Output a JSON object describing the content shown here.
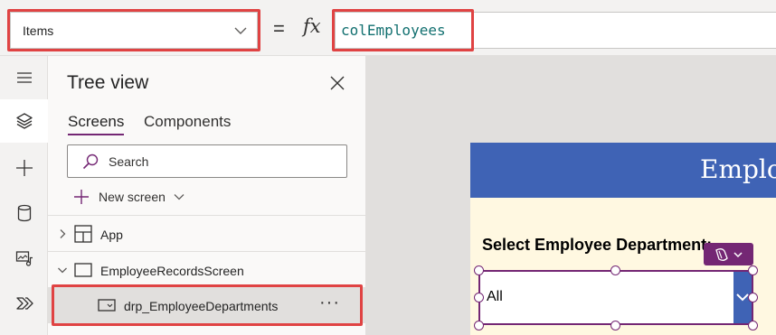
{
  "formula_bar": {
    "property": "Items",
    "equals": "=",
    "fx": "fx",
    "formula": "colEmployees"
  },
  "rail": {
    "items": [
      {
        "icon": "hamburger-menu-icon"
      },
      {
        "icon": "layers-icon",
        "active": true
      },
      {
        "icon": "plus-icon"
      },
      {
        "icon": "database-icon"
      },
      {
        "icon": "media-icon"
      },
      {
        "icon": "power-automate-icon"
      }
    ]
  },
  "tree_view": {
    "title": "Tree view",
    "tabs": [
      "Screens",
      "Components"
    ],
    "active_tab": "Screens",
    "search_placeholder": "Search",
    "new_screen_label": "New screen",
    "items": [
      {
        "label": "App",
        "icon": "app-icon"
      },
      {
        "label": "EmployeeRecordsScreen",
        "icon": "screen-icon"
      },
      {
        "label": "drp_EmployeeDepartments",
        "icon": "dropdown-icon",
        "selected": true,
        "more": "···"
      }
    ]
  },
  "canvas": {
    "header_title": "Emplo",
    "label": "Select Employee Department:",
    "dropdown_value": "All"
  },
  "colors": {
    "accent": "#742774",
    "header": "#3f63b5",
    "highlight": "#e04343",
    "screen_bg": "#fff8e1"
  }
}
